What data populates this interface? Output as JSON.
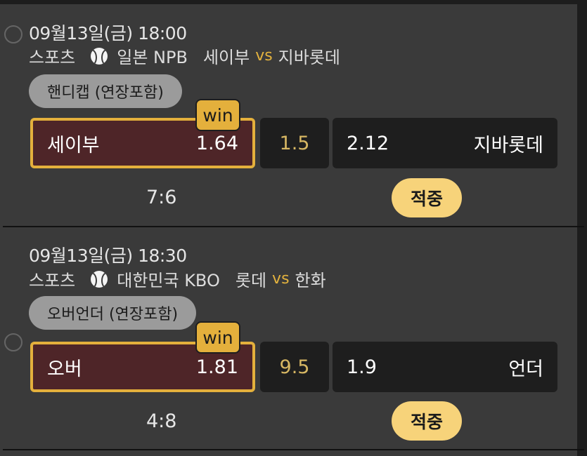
{
  "bets": [
    {
      "datetime": "09월13일(금) 18:00",
      "category": "스포츠",
      "sport_icon": "baseball-icon",
      "league": "일본 NPB",
      "home": "세이부",
      "vs": "vs",
      "away": "지바롯데",
      "market": "핸디캡 (연장포함)",
      "selection": {
        "label": "세이부",
        "odds": "1.64"
      },
      "line": "1.5",
      "opposite": {
        "odds": "2.12",
        "label": "지바롯데"
      },
      "badge": "win",
      "score": "7:6",
      "result": "적중"
    },
    {
      "datetime": "09월13일(금) 18:30",
      "category": "스포츠",
      "sport_icon": "baseball-icon",
      "league": "대한민국 KBO",
      "home": "롯데",
      "vs": "vs",
      "away": "한화",
      "market": "오버언더 (연장포함)",
      "selection": {
        "label": "오버",
        "odds": "1.81"
      },
      "line": "9.5",
      "opposite": {
        "odds": "1.9",
        "label": "언더"
      },
      "badge": "win",
      "score": "4:8",
      "result": "적중"
    }
  ],
  "colors": {
    "accent": "#e4b03c",
    "selected_bg": "#4e2528",
    "hit_badge": "#f7d37a"
  }
}
